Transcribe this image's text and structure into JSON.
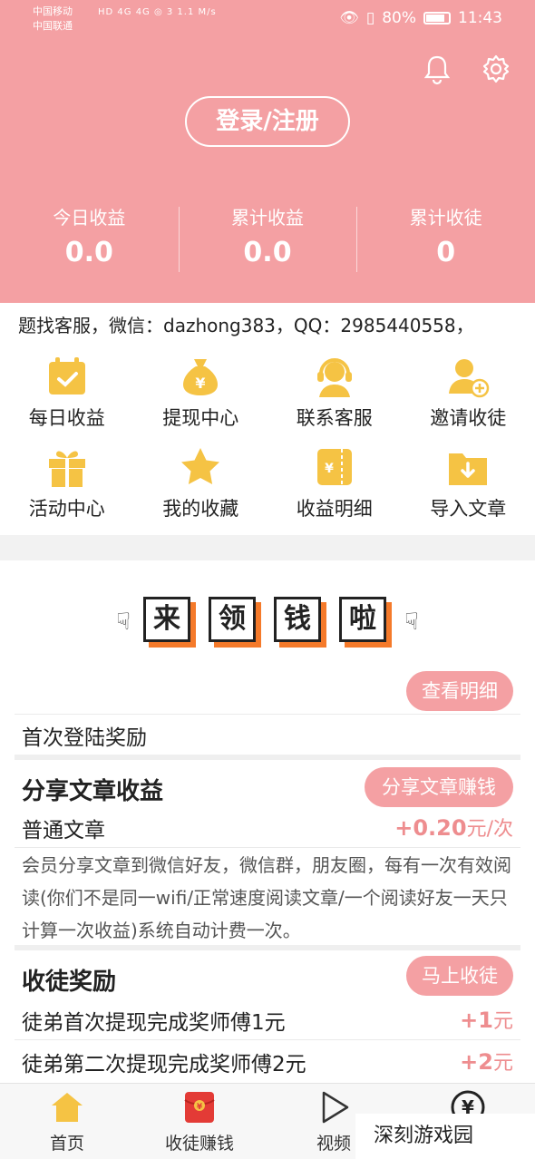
{
  "status_bar": {
    "carrier1": "中国移动",
    "carrier2": "中国联通",
    "net": "HD  4G  4G  ◎ 3  1.1 M/s",
    "battery": "80%",
    "time": "11:43"
  },
  "header": {
    "login_label": "登录/注册",
    "stats": [
      {
        "label": "今日收益",
        "value": "0.0"
      },
      {
        "label": "累计收益",
        "value": "0.0"
      },
      {
        "label": "累计收徒",
        "value": "0"
      }
    ]
  },
  "marquee_text": "题找客服，微信：dazhong383，QQ：2985440558，",
  "grid": [
    {
      "label": "每日收益",
      "icon": "calendar-check-icon"
    },
    {
      "label": "提现中心",
      "icon": "money-bag-icon"
    },
    {
      "label": "联系客服",
      "icon": "headset-icon"
    },
    {
      "label": "邀请收徒",
      "icon": "add-user-icon"
    },
    {
      "label": "活动中心",
      "icon": "gift-icon"
    },
    {
      "label": "我的收藏",
      "icon": "star-icon"
    },
    {
      "label": "收益明细",
      "icon": "ticket-icon"
    },
    {
      "label": "导入文章",
      "icon": "folder-download-icon"
    }
  ],
  "banner": [
    "来",
    "领",
    "钱",
    "啦"
  ],
  "rewards": {
    "detail_button": "查看明细",
    "first_login": "首次登陆奖励",
    "share_title": "分享文章收益",
    "share_button": "分享文章赚钱",
    "normal_article": "普通文章",
    "normal_price": "+0.20",
    "normal_unit": "元/次",
    "share_desc": "会员分享文章到微信好友，微信群，朋友圈，每有一次有效阅读(你们不是同一wifi/正常速度阅读文章/一个阅读好友一天只计算一次收益)系统自动计费一次。",
    "apprentice_title": "收徒奖励",
    "apprentice_button": "马上收徒",
    "apprentice_row1": "徒弟首次提现完成奖师傅1元",
    "apprentice_row1_price": "+1",
    "apprentice_row2": "徒弟第二次提现完成奖师傅2元",
    "apprentice_row2_price": "+2",
    "unit_yuan": "元"
  },
  "nav": [
    {
      "label": "首页",
      "icon": "home-icon"
    },
    {
      "label": "收徒赚钱",
      "icon": "red-envelope-icon"
    },
    {
      "label": "视频",
      "icon": "play-icon"
    },
    {
      "label": "",
      "icon": "yen-icon"
    }
  ],
  "watermark": "深刻游戏园",
  "colors": {
    "accent": "#f4a0a3",
    "icon_gold": "#f5c344",
    "price": "#ee8d8f",
    "tile_shadow": "#f57a2a"
  }
}
